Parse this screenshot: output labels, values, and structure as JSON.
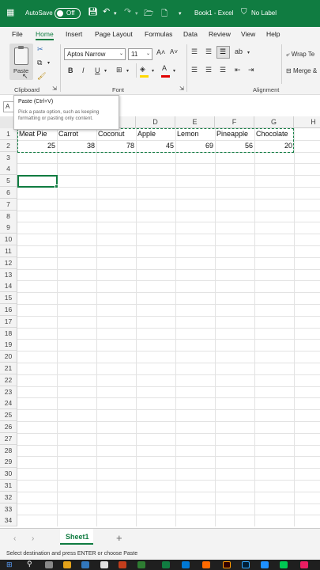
{
  "titlebar": {
    "autosave_label": "AutoSave",
    "autosave_state": "Off",
    "book_title": "Book1 - Excel",
    "sensitivity": "No Label"
  },
  "menu": {
    "items": [
      "File",
      "Home",
      "Insert",
      "Page Layout",
      "Formulas",
      "Data",
      "Review",
      "View",
      "Help"
    ]
  },
  "ribbon": {
    "paste_label": "Paste",
    "font_name": "Aptos Narrow",
    "font_size": "11",
    "wrap_text": "Wrap Te",
    "merge": "Merge &",
    "groups": {
      "clipboard": "Clipboard",
      "font": "Font",
      "alignment": "Alignment"
    },
    "bold": "B",
    "italic": "I",
    "underline": "U"
  },
  "tooltip": {
    "title": "Paste (Ctrl+V)",
    "body": "Pick a paste option, such as keeping formatting or pasting only content."
  },
  "namebox": "A",
  "columns": [
    "",
    "C",
    "D",
    "E",
    "F",
    "G",
    "H"
  ],
  "row1": [
    "Meat Pie",
    "Carrot",
    "Coconut",
    "Apple",
    "Lemon",
    "Pineapple",
    "Chocolate"
  ],
  "row2": [
    "25",
    "38",
    "78",
    "45",
    "69",
    "56",
    "20"
  ],
  "rows": [
    "1",
    "2",
    "3",
    "4",
    "5",
    "6",
    "7",
    "8",
    "9",
    "10",
    "11",
    "12",
    "13",
    "14",
    "15",
    "16",
    "17",
    "18",
    "19",
    "20",
    "21",
    "22",
    "23",
    "24",
    "25",
    "26",
    "27",
    "28",
    "29",
    "30",
    "31",
    "32",
    "33",
    "34"
  ],
  "sheet_tab": "Sheet1",
  "add_sheet": "+",
  "status_text": "Select destination and press ENTER or choose Paste",
  "colors": {
    "brand": "#107c41",
    "selection": "#107c41"
  }
}
